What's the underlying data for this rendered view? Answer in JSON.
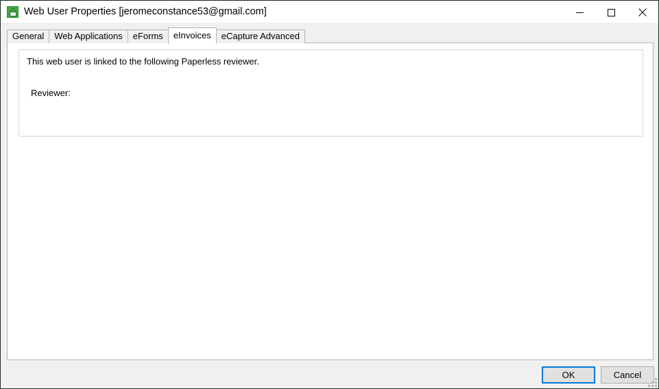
{
  "window": {
    "title": "Web User Properties [jeromeconstance53@gmail.com]",
    "icon": "web-user-lock-icon",
    "border_color": "#1d3024",
    "titlebar_bg": "#ffffff",
    "controls": {
      "minimize": "Minimize",
      "maximize": "Maximize",
      "close": "Close"
    }
  },
  "tabs": [
    {
      "label": "General",
      "selected": false
    },
    {
      "label": "Web Applications",
      "selected": false
    },
    {
      "label": "eForms",
      "selected": false
    },
    {
      "label": "eInvoices",
      "selected": true
    },
    {
      "label": "eCapture Advanced",
      "selected": false
    }
  ],
  "content": {
    "linked_text": "This web user is linked to the following Paperless reviewer.",
    "reviewer_label": "Reviewer:",
    "reviewer_value": ""
  },
  "footer": {
    "ok_label": "OK",
    "cancel_label": "Cancel",
    "default_button_accent": "#0078d7"
  }
}
